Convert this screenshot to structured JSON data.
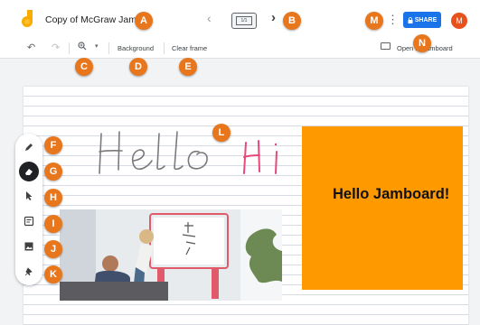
{
  "header": {
    "title": "Copy of McGraw Jam",
    "frame_indicator": "1/1",
    "share_label": "SHARE",
    "avatar_initial": "M"
  },
  "toolbar": {
    "background_label": "Background",
    "clear_frame_label": "Clear frame",
    "open_label": "Open in Jamboard"
  },
  "canvas": {
    "handwriting_hello": "Hello",
    "handwriting_hi": "Hi",
    "sticky_text": "Hello Jamboard!"
  },
  "markers": [
    "A",
    "B",
    "C",
    "D",
    "E",
    "F",
    "G",
    "H",
    "I",
    "J",
    "K",
    "L",
    "M",
    "N"
  ],
  "colors": {
    "accent": "#1a73e8",
    "marker": "#e8761c",
    "sticky": "#ff9900",
    "avatar": "#e8501c",
    "hi_ink": "#e8497a"
  },
  "icons": {
    "logo": "jamboard-logo-icon",
    "undo": "undo-icon",
    "redo": "redo-icon",
    "zoom": "zoom-icon",
    "pen": "pen-icon",
    "eraser": "eraser-icon",
    "select": "select-icon",
    "sticky": "sticky-note-icon",
    "image": "image-icon",
    "laser": "laser-icon"
  }
}
